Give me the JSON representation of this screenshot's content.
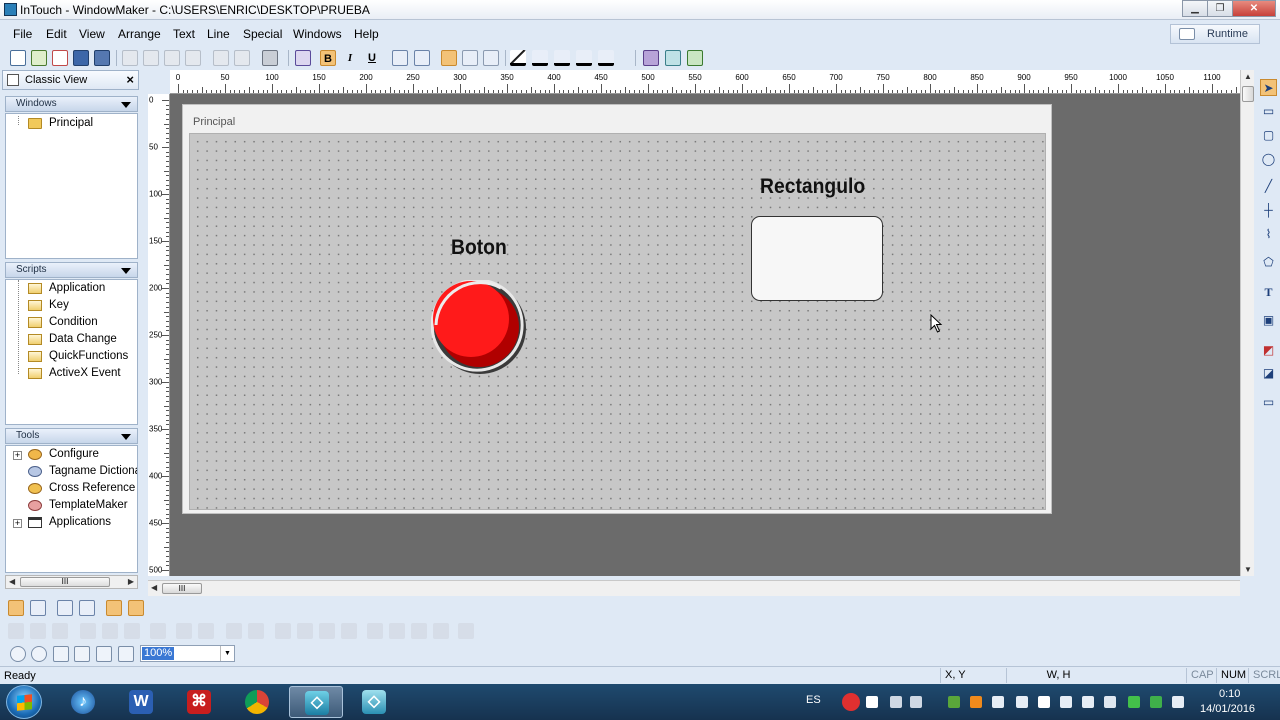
{
  "window": {
    "title": "InTouch - WindowMaker - C:\\USERS\\ENRIC\\DESKTOP\\PRUEBA",
    "minimize": "▁",
    "maximize": "❐",
    "close": "✕"
  },
  "menu": {
    "items": [
      "File",
      "Edit",
      "View",
      "Arrange",
      "Text",
      "Line",
      "Special",
      "Windows",
      "Help"
    ],
    "runtime_label": "Runtime"
  },
  "classic_view": {
    "title": "Classic View",
    "close": "×",
    "windows_section": {
      "title": "Windows",
      "items": [
        "Principal"
      ]
    },
    "scripts_section": {
      "title": "Scripts",
      "items": [
        "Application",
        "Key",
        "Condition",
        "Data Change",
        "QuickFunctions",
        "ActiveX Event"
      ]
    },
    "tools_section": {
      "title": "Tools",
      "items": [
        "Configure",
        "Tagname Dictiona",
        "Cross Reference",
        "TemplateMaker",
        "Applications"
      ]
    },
    "scroll_thumb": "III"
  },
  "rulers": {
    "horizontal": [
      "0",
      "50",
      "100",
      "150",
      "200",
      "250",
      "300",
      "350",
      "400",
      "450",
      "500",
      "550",
      "600",
      "650",
      "700",
      "750",
      "800",
      "850",
      "900",
      "950",
      "1000",
      "1050",
      "1100"
    ],
    "vertical": [
      "0",
      "50",
      "100",
      "150",
      "200",
      "250",
      "300",
      "350",
      "400",
      "450",
      "500"
    ]
  },
  "canvas": {
    "window_name": "Principal",
    "button_label": "Boton",
    "rectangle_label": "Rectangulo",
    "hscroll_thumb": "III"
  },
  "toolbar": {
    "bold": "B",
    "italic": "I",
    "underline": "U"
  },
  "zoom": {
    "value": "100%"
  },
  "status": {
    "text": "Ready",
    "xy": "X, Y",
    "wh": "W, H",
    "cap": "CAP",
    "num": "NUM",
    "scrl": "SCRL"
  },
  "taskbar": {
    "language": "ES",
    "time": "0:10",
    "date": "14/01/2016",
    "word_glyph": "W"
  },
  "colors": {
    "button_red": "#ff1a1a",
    "canvas_bg": "#c7c7c7",
    "workspace_bg": "#6b6b6b",
    "chrome_bg": "#dfe9f5"
  }
}
